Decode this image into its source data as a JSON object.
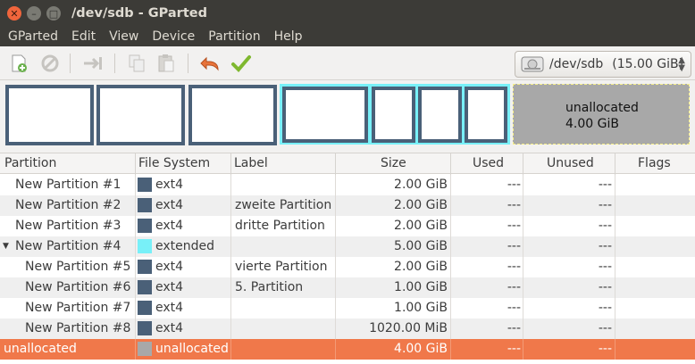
{
  "window": {
    "title": "/dev/sdb - GParted"
  },
  "menu": [
    "GParted",
    "Edit",
    "View",
    "Device",
    "Partition",
    "Help"
  ],
  "toolbar": {
    "icons": [
      "new-partition-icon",
      "delete-icon",
      "resize-move-icon",
      "copy-icon",
      "paste-icon",
      "undo-icon",
      "apply-icon"
    ],
    "device": "/dev/sdb",
    "device_size": "(15.00 GiB)"
  },
  "visualizer": {
    "unallocated_label": "unallocated",
    "unallocated_size": "4.00 GiB"
  },
  "columns": [
    "Partition",
    "File System",
    "Label",
    "Size",
    "Used",
    "Unused",
    "Flags"
  ],
  "rows": [
    {
      "partition": "New Partition #1",
      "fs": "ext4",
      "fs_color": "#4a6078",
      "label": "",
      "size": "2.00 GiB",
      "used": "---",
      "unused": "---",
      "flags": ""
    },
    {
      "partition": "New Partition #2",
      "fs": "ext4",
      "fs_color": "#4a6078",
      "label": "zweite Partition",
      "size": "2.00 GiB",
      "used": "---",
      "unused": "---",
      "flags": ""
    },
    {
      "partition": "New Partition #3",
      "fs": "ext4",
      "fs_color": "#4a6078",
      "label": "dritte Partition",
      "size": "2.00 GiB",
      "used": "---",
      "unused": "---",
      "flags": ""
    },
    {
      "partition": "New Partition #4",
      "fs": "extended",
      "fs_color": "#78f0f8",
      "label": "",
      "size": "5.00 GiB",
      "used": "---",
      "unused": "---",
      "flags": ""
    },
    {
      "partition": "New Partition #5",
      "fs": "ext4",
      "fs_color": "#4a6078",
      "label": "vierte Partition",
      "size": "2.00 GiB",
      "used": "---",
      "unused": "---",
      "flags": ""
    },
    {
      "partition": "New Partition #6",
      "fs": "ext4",
      "fs_color": "#4a6078",
      "label": "5. Partition",
      "size": "1.00 GiB",
      "used": "---",
      "unused": "---",
      "flags": ""
    },
    {
      "partition": "New Partition #7",
      "fs": "ext4",
      "fs_color": "#4a6078",
      "label": "",
      "size": "1.00 GiB",
      "used": "---",
      "unused": "---",
      "flags": ""
    },
    {
      "partition": "New Partition #8",
      "fs": "ext4",
      "fs_color": "#4a6078",
      "label": "",
      "size": "1020.00 MiB",
      "used": "---",
      "unused": "---",
      "flags": ""
    },
    {
      "partition": "unallocated",
      "fs": "unallocated",
      "fs_color": "#a8a8a8",
      "label": "",
      "size": "4.00 GiB",
      "used": "---",
      "unused": "---",
      "flags": ""
    }
  ]
}
